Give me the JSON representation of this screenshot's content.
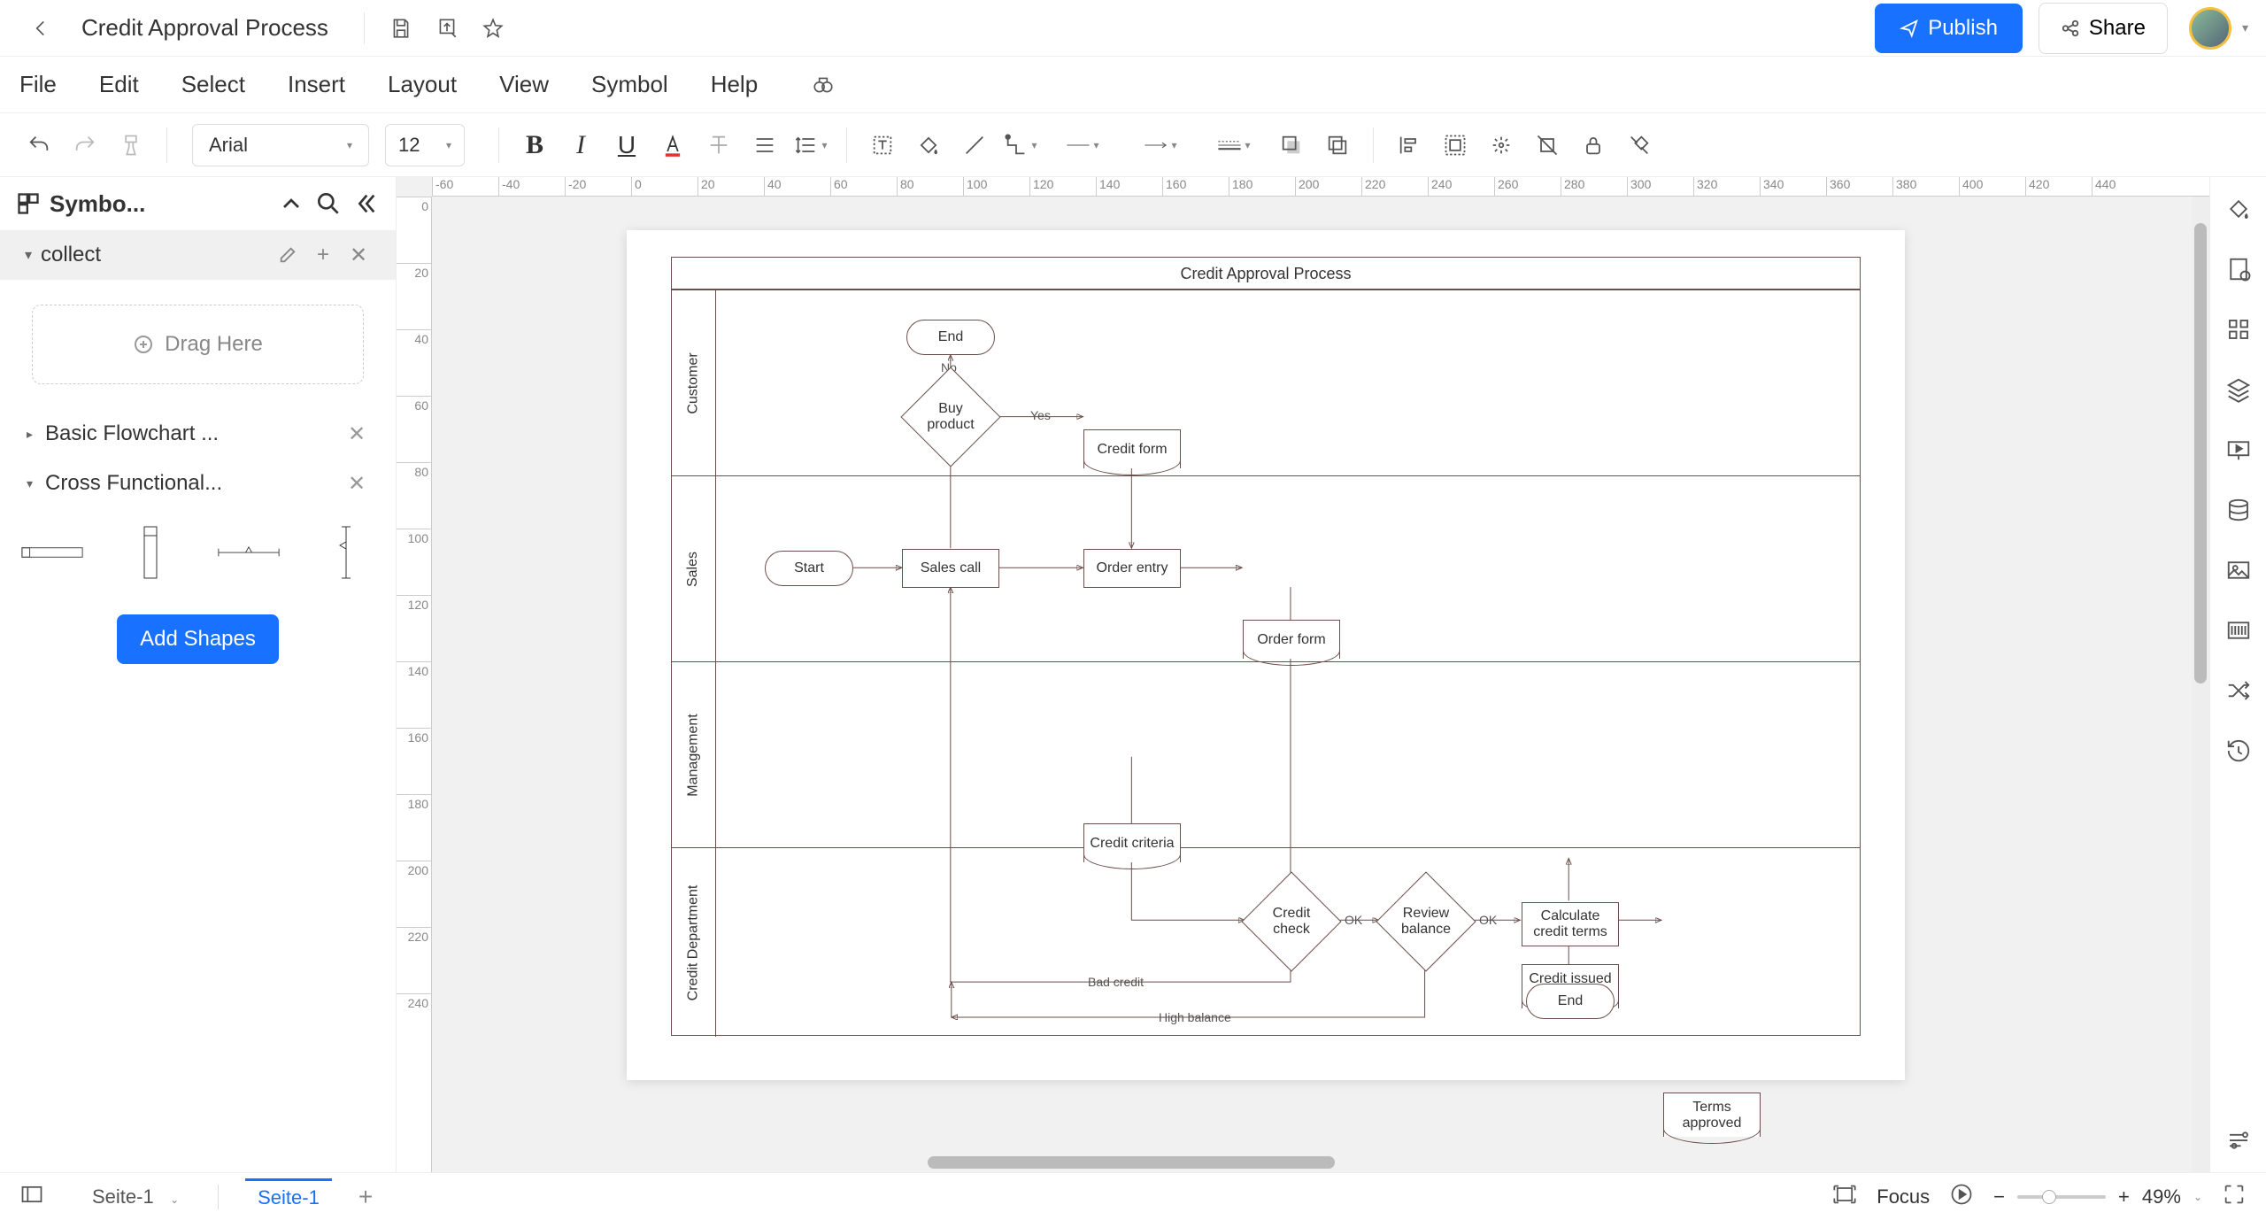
{
  "titlebar": {
    "doc_title": "Credit Approval Process",
    "publish": "Publish",
    "share": "Share"
  },
  "menubar": {
    "items": [
      "File",
      "Edit",
      "Select",
      "Insert",
      "Layout",
      "View",
      "Symbol",
      "Help"
    ]
  },
  "toolbar": {
    "font": "Arial",
    "font_size": "12"
  },
  "leftpanel": {
    "title": "Symbo...",
    "collect": "collect",
    "drag_here": "Drag Here",
    "cat_basic": "Basic Flowchart ...",
    "cat_cross": "Cross Functional...",
    "add_shapes": "Add Shapes"
  },
  "statusbar": {
    "page_select": "Seite-1",
    "active_tab": "Seite-1",
    "focus": "Focus",
    "zoom": "49%"
  },
  "chart_data": {
    "type": "swimlane-flowchart",
    "title": "Credit Approval Process",
    "lanes": [
      "Customer",
      "Sales",
      "Management",
      "Credit Department"
    ],
    "nodes": [
      {
        "id": "end1",
        "lane": "Customer",
        "type": "terminator",
        "label": "End"
      },
      {
        "id": "buy",
        "lane": "Customer",
        "type": "decision",
        "label": "Buy product"
      },
      {
        "id": "creditform",
        "lane": "Customer",
        "type": "document",
        "label": "Credit form"
      },
      {
        "id": "start",
        "lane": "Sales",
        "type": "terminator",
        "label": "Start"
      },
      {
        "id": "salescall",
        "lane": "Sales",
        "type": "process",
        "label": "Sales call"
      },
      {
        "id": "orderentry",
        "lane": "Sales",
        "type": "process",
        "label": "Order entry"
      },
      {
        "id": "orderform",
        "lane": "Sales",
        "type": "document",
        "label": "Order form"
      },
      {
        "id": "creditcriteria",
        "lane": "Management",
        "type": "document",
        "label": "Credit criteria"
      },
      {
        "id": "creditissued",
        "lane": "Management",
        "type": "document",
        "label": "Credit issued report"
      },
      {
        "id": "creditcheck",
        "lane": "Credit Department",
        "type": "decision",
        "label": "Credit check"
      },
      {
        "id": "reviewbal",
        "lane": "Credit Department",
        "type": "decision",
        "label": "Review balance"
      },
      {
        "id": "calcterms",
        "lane": "Credit Department",
        "type": "process",
        "label": "Calculate credit terms"
      },
      {
        "id": "termsappr",
        "lane": "Credit Department",
        "type": "document",
        "label": "Terms approved"
      },
      {
        "id": "end2",
        "lane": "Credit Department",
        "type": "terminator",
        "label": "End"
      }
    ],
    "edges": [
      {
        "from": "start",
        "to": "salescall"
      },
      {
        "from": "salescall",
        "to": "buy"
      },
      {
        "from": "buy",
        "to": "end1",
        "label": "No"
      },
      {
        "from": "buy",
        "to": "creditform",
        "label": "Yes"
      },
      {
        "from": "buy",
        "to": "orderentry",
        "label": "Yes"
      },
      {
        "from": "creditform",
        "to": "orderentry"
      },
      {
        "from": "orderentry",
        "to": "orderform"
      },
      {
        "from": "orderform",
        "to": "creditcheck"
      },
      {
        "from": "creditcriteria",
        "to": "creditcheck"
      },
      {
        "from": "creditcheck",
        "to": "salescall",
        "label": "Bad credit"
      },
      {
        "from": "creditcheck",
        "to": "reviewbal",
        "label": "OK"
      },
      {
        "from": "reviewbal",
        "to": "salescall",
        "label": "High balance"
      },
      {
        "from": "reviewbal",
        "to": "calcterms",
        "label": "OK"
      },
      {
        "from": "calcterms",
        "to": "termsappr"
      },
      {
        "from": "calcterms",
        "to": "creditissued"
      },
      {
        "from": "calcterms",
        "to": "end2"
      }
    ]
  },
  "ruler_h": [
    "-60",
    "-40",
    "-20",
    "0",
    "20",
    "40",
    "60",
    "80",
    "100",
    "120",
    "140",
    "160",
    "180",
    "200",
    "220",
    "240",
    "260",
    "280",
    "300",
    "320",
    "340",
    "360",
    "380",
    "400",
    "420",
    "440"
  ],
  "ruler_v": [
    "0",
    "20",
    "40",
    "60",
    "80",
    "100",
    "120",
    "140",
    "160",
    "180",
    "200",
    "220",
    "240"
  ]
}
